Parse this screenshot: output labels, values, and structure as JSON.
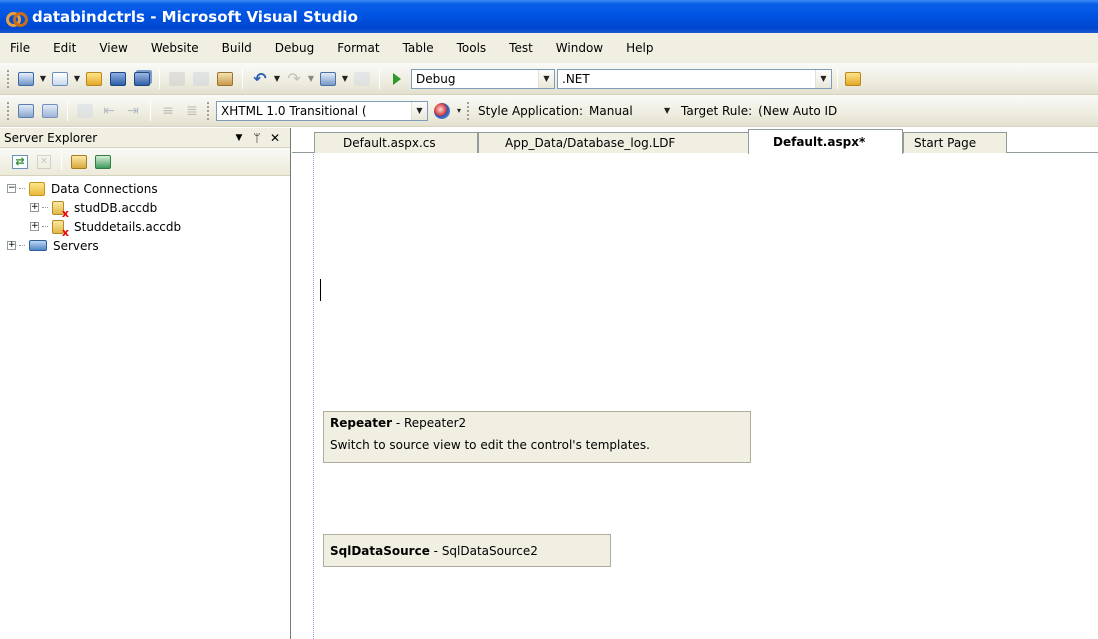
{
  "window": {
    "title": "databindctrls - Microsoft Visual Studio"
  },
  "menu": [
    "File",
    "Edit",
    "View",
    "Website",
    "Build",
    "Debug",
    "Format",
    "Table",
    "Tools",
    "Test",
    "Window",
    "Help"
  ],
  "toolbar1": {
    "config_value": "Debug",
    "platform_value": ".NET"
  },
  "toolbar2": {
    "doctype_value": "XHTML 1.0 Transitional (",
    "style_app_label": "Style Application:",
    "style_app_value": "Manual",
    "target_rule_label": "Target Rule:",
    "target_rule_value": "(New Auto ID"
  },
  "server_explorer": {
    "title": "Server Explorer",
    "pin_glyph": "ᛘ",
    "close_glyph": "✕",
    "tree": {
      "data_connections": "Data Connections",
      "items": [
        "studDB.accdb",
        "Studdetails.accdb"
      ],
      "servers": "Servers"
    }
  },
  "tabs": [
    "Default.aspx.cs",
    "App_Data/Database_log.LDF",
    "Default.aspx*",
    "Start Page"
  ],
  "active_tab": "Default.aspx*",
  "design": {
    "repeater": {
      "type": "Repeater",
      "id": "Repeater2",
      "message": "Switch to source view to edit the control's templates."
    },
    "sqldatasource": {
      "type": "SqlDataSource",
      "id": "SqlDataSource2"
    }
  },
  "colors": {
    "titlebar": "#0054e3",
    "chrome": "#f1efe2"
  }
}
